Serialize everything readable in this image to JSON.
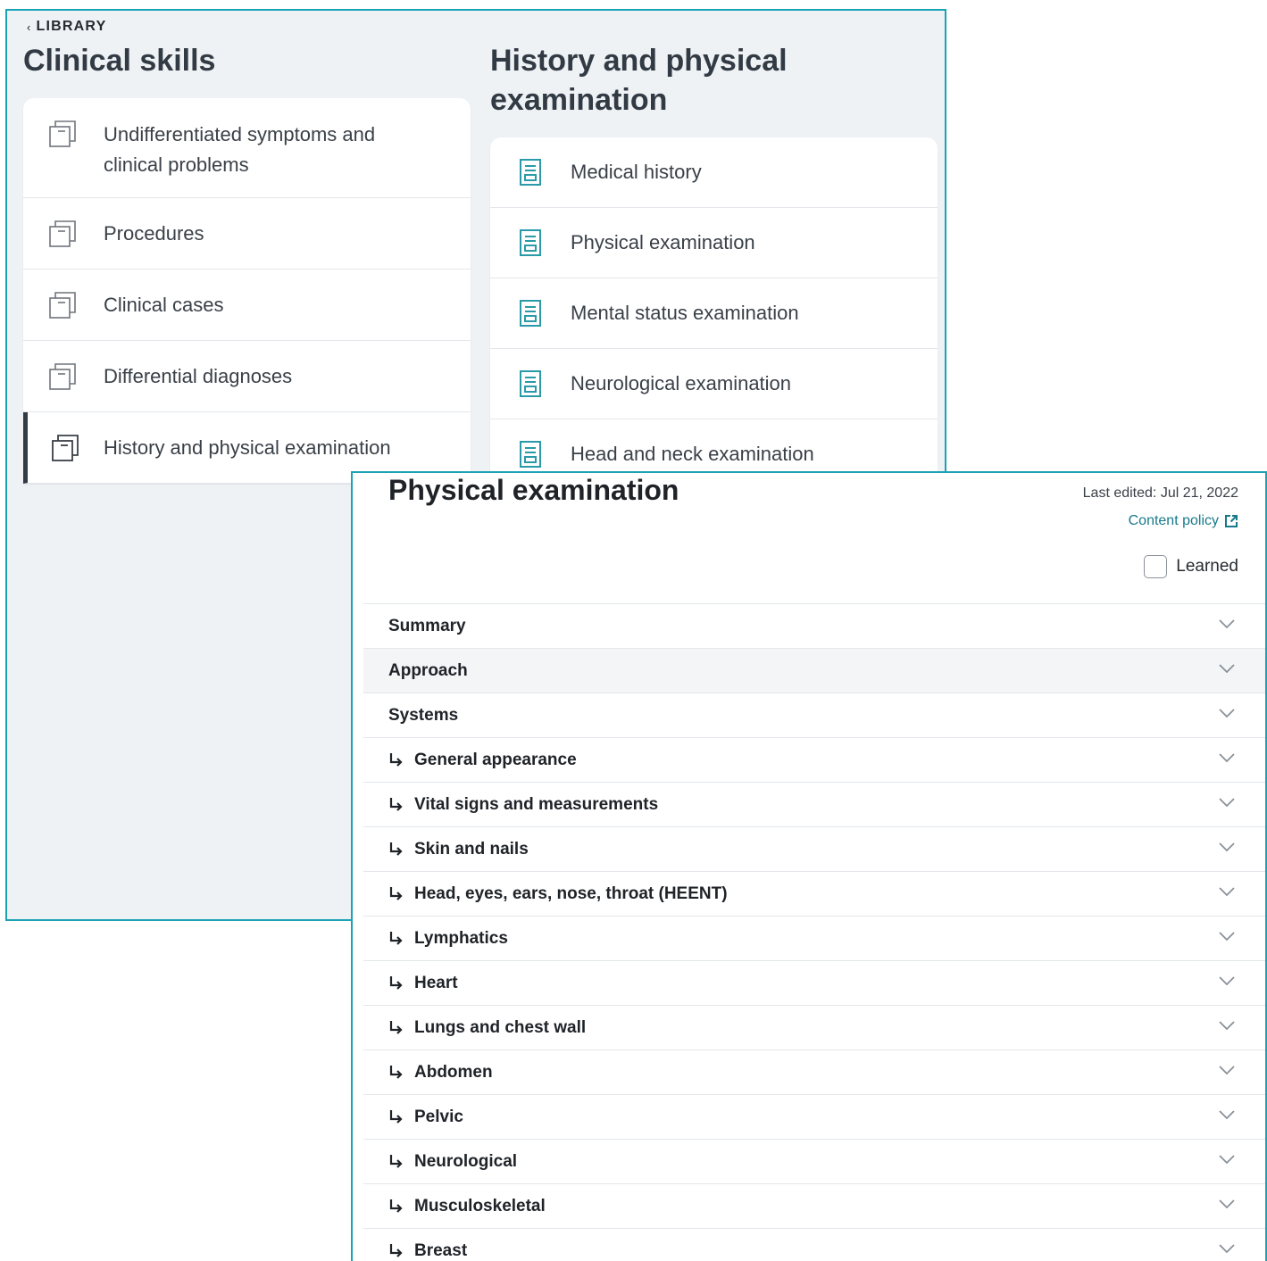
{
  "library": {
    "back_label": "LIBRARY",
    "title": "Clinical skills",
    "categories": [
      {
        "label": "Undifferentiated symptoms and clinical problems"
      },
      {
        "label": "Procedures"
      },
      {
        "label": "Clinical cases"
      },
      {
        "label": "Differential diagnoses"
      },
      {
        "label": "History and physical examination",
        "active": true
      }
    ]
  },
  "subcategory": {
    "title": "History and physical examination",
    "items": [
      {
        "label": "Medical history"
      },
      {
        "label": "Physical examination"
      },
      {
        "label": "Mental status examination"
      },
      {
        "label": "Neurological examination"
      },
      {
        "label": "Head and neck examination"
      }
    ]
  },
  "article": {
    "title": "Physical examination",
    "last_edited": "Last edited: Jul 21, 2022",
    "content_policy": "Content policy",
    "learned_label": "Learned",
    "learned_checked": false,
    "sections": [
      {
        "label": "Summary",
        "sub": false
      },
      {
        "label": "Approach",
        "sub": false,
        "highlight": true
      },
      {
        "label": "Systems",
        "sub": false
      },
      {
        "label": "General appearance",
        "sub": true
      },
      {
        "label": "Vital signs and measurements",
        "sub": true
      },
      {
        "label": "Skin and nails",
        "sub": true
      },
      {
        "label": "Head, eyes, ears, nose, throat (HEENT)",
        "sub": true
      },
      {
        "label": "Lymphatics",
        "sub": true
      },
      {
        "label": "Heart",
        "sub": true
      },
      {
        "label": "Lungs and chest wall",
        "sub": true
      },
      {
        "label": "Abdomen",
        "sub": true
      },
      {
        "label": "Pelvic",
        "sub": true
      },
      {
        "label": "Neurological",
        "sub": true
      },
      {
        "label": "Musculoskeletal",
        "sub": true
      },
      {
        "label": "Breast",
        "sub": true
      }
    ]
  },
  "colors": {
    "accent": "#1aa3b5",
    "link": "#177a8a",
    "panel_bg": "#eef2f5",
    "doc_icon": "#2a9aa8",
    "folder_icon": "#6f757c"
  },
  "icons": {
    "back": "chevron-left-icon",
    "category": "stacked-folder-icon",
    "document": "document-icon",
    "external": "external-link-icon",
    "expand": "chevron-down-icon",
    "subsection": "subdirectory-arrow-icon"
  }
}
